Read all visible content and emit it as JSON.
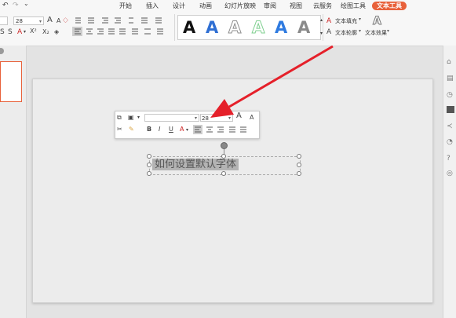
{
  "tabs": [
    "开始",
    "插入",
    "设计",
    "动画",
    "幻灯片放映",
    "审阅",
    "视图",
    "云服务",
    "绘图工具",
    "文本工具"
  ],
  "quick_access": {
    "undo": "↶",
    "redo": "↷",
    "more": "⌄"
  },
  "font": {
    "size_value": "28"
  },
  "font_buttons": {
    "grow": "A",
    "shrink": "A",
    "clear_format": "◇"
  },
  "style_letters": [
    {
      "letter": "A",
      "color": "#111111",
      "variant": "solid"
    },
    {
      "letter": "A",
      "color": "#2f6fd3",
      "variant": "solid"
    },
    {
      "letter": "A",
      "color": "#8c8c8c",
      "variant": "outline"
    },
    {
      "letter": "A",
      "color": "#7fcf8f",
      "variant": "outline"
    },
    {
      "letter": "A",
      "color": "#2f7be0",
      "variant": "solid"
    },
    {
      "letter": "A",
      "color": "#8a8a8a",
      "variant": "solid"
    }
  ],
  "text_tools": {
    "fill": "文本填充",
    "outline": "文本轮廓",
    "effect": "文本效果"
  },
  "mini_toolbar": {
    "font_value": "",
    "size_value": "28"
  },
  "textbox": {
    "content": "如何设置默认字体"
  },
  "colors": {
    "accent": "#e8613a",
    "arrow": "#e5202a"
  }
}
